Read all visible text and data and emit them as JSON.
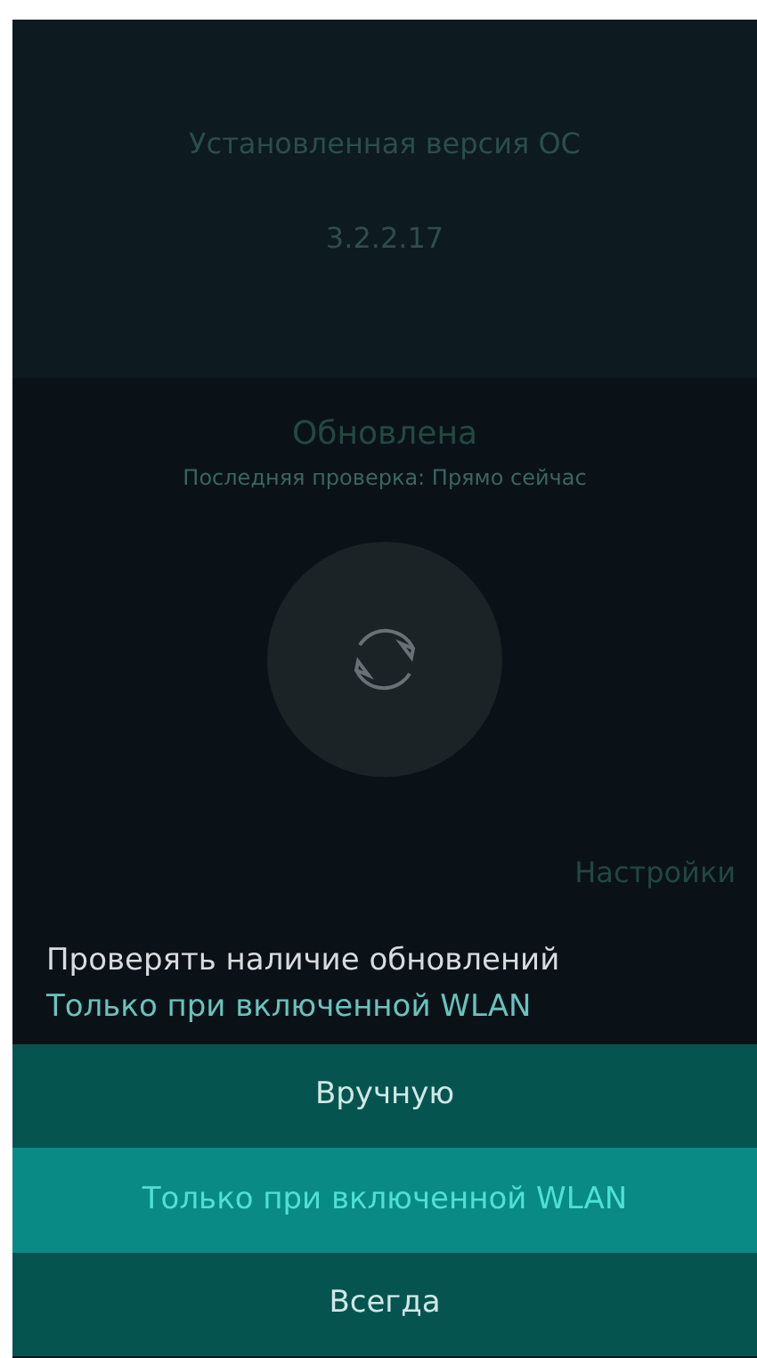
{
  "header": {
    "label": "Установленная версия ОС",
    "version": "3.2.2.17"
  },
  "status": {
    "title": "Обновлена",
    "subtitle": "Последняя проверка: Прямо сейчас"
  },
  "section_header": "Настройки",
  "combo": {
    "label": "Проверять наличие обновлений",
    "value": "Только при включенной WLAN"
  },
  "menu": [
    {
      "label": "Вручную",
      "selected": false
    },
    {
      "label": "Только при включенной WLAN",
      "selected": true
    },
    {
      "label": "Всегда",
      "selected": false
    }
  ]
}
